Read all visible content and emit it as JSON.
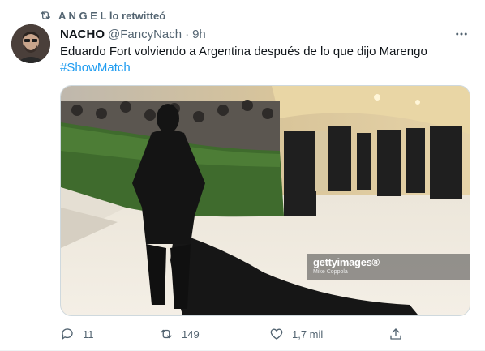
{
  "retweet": {
    "by": "A N G E L",
    "suffix": "lo retwitteó",
    "icon": "retweet-icon"
  },
  "author": {
    "name": "NACHO",
    "handle": "@FancyNach",
    "separator": "·",
    "time": "9h"
  },
  "tweet": {
    "text": "Eduardo Fort volviendo a Argentina después de lo que dijo Marengo",
    "hashtag": "#ShowMatch"
  },
  "media": {
    "watermark_brand": "gettyimages®",
    "watermark_credit": "Mike Coppola"
  },
  "actions": {
    "replies": "11",
    "retweets": "149",
    "likes": "1,7 mil"
  },
  "colors": {
    "accent": "#1d9bf0",
    "muted": "#536471",
    "text": "#0f1419"
  }
}
